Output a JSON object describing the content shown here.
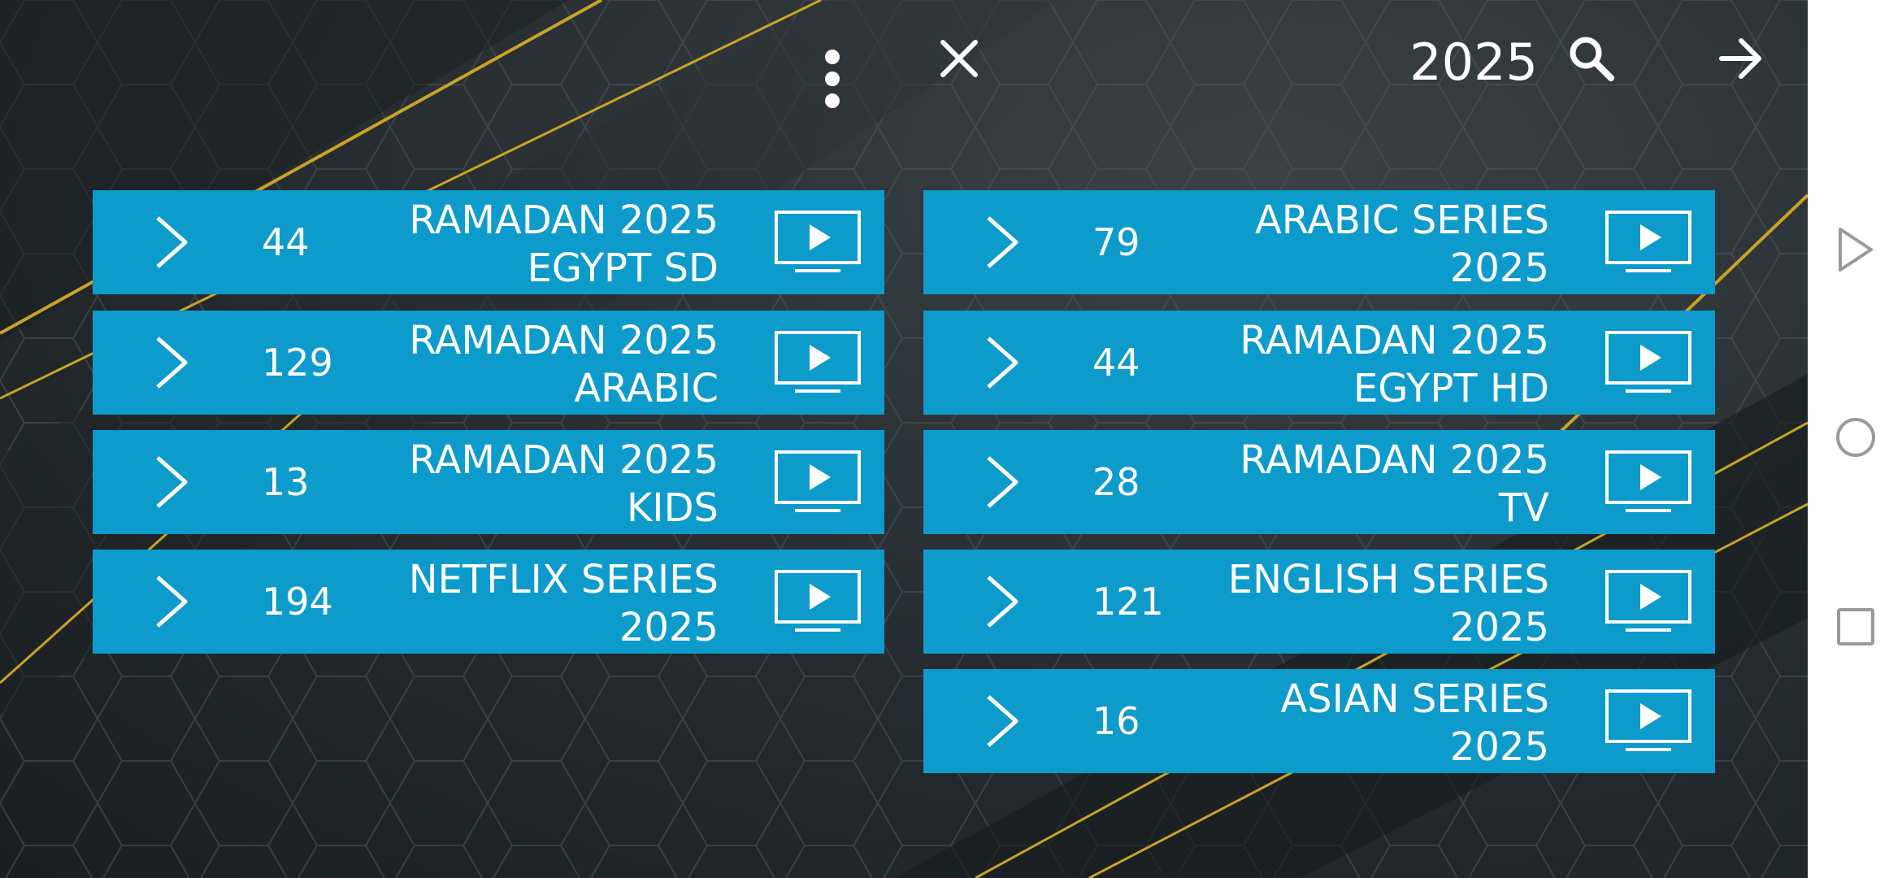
{
  "toolbar": {
    "search_value": "2025",
    "icons": [
      "more-vert-icon",
      "close-icon",
      "search-icon",
      "arrow-forward-icon"
    ]
  },
  "categories_left": [
    {
      "count": "44",
      "title_line1": "RAMADAN 2025",
      "title_line2": "EGYPT SD"
    },
    {
      "count": "129",
      "title_line1": "RAMADAN 2025",
      "title_line2": "ARABIC"
    },
    {
      "count": "13",
      "title_line1": "RAMADAN 2025",
      "title_line2": "KIDS"
    },
    {
      "count": "194",
      "title_line1": "NETFLIX SERIES",
      "title_line2": "2025"
    }
  ],
  "categories_right": [
    {
      "count": "79",
      "title_line1": "ARABIC SERIES",
      "title_line2": "2025"
    },
    {
      "count": "44",
      "title_line1": "RAMADAN 2025",
      "title_line2": "EGYPT HD"
    },
    {
      "count": "28",
      "title_line1": "RAMADAN 2025",
      "title_line2": "TV"
    },
    {
      "count": "121",
      "title_line1": "ENGLISH SERIES",
      "title_line2": "2025"
    },
    {
      "count": "16",
      "title_line1": "ASIAN SERIES",
      "title_line2": "2025"
    }
  ],
  "colors": {
    "row_background": "#0d9bcc",
    "background": "#252b2e",
    "accent_gold": "#c9a227",
    "text": "#ffffff"
  },
  "system_nav": {
    "icons": [
      "back-icon",
      "home-icon",
      "recents-icon"
    ]
  }
}
